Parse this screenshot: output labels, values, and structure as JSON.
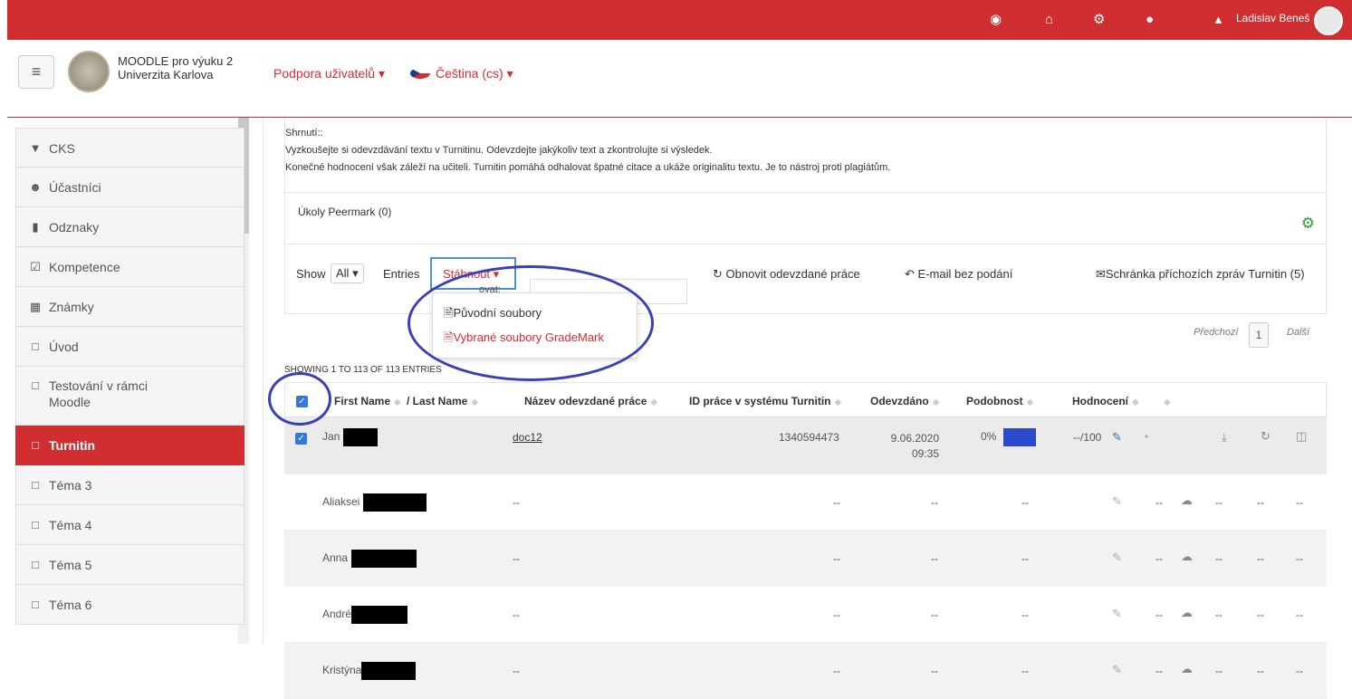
{
  "topbar": {
    "user_name": "Ladislav Beneš",
    "icons": [
      "dashboard-icon",
      "home-icon",
      "sitemap-icon",
      "chat-icon",
      "bell-icon"
    ]
  },
  "header": {
    "site_name_line1": "MOODLE pro výuku 2",
    "site_name_line2": "Univerzita Karlova",
    "menu_support": "Podpora uživatelů ▾",
    "menu_language": "Čeština (cs) ▾"
  },
  "sidebar": {
    "items": [
      {
        "label": "CKS",
        "icon": "graduation-cap-icon"
      },
      {
        "label": "Účastníci",
        "icon": "users-icon"
      },
      {
        "label": "Odznaky",
        "icon": "shield-icon"
      },
      {
        "label": "Kompetence",
        "icon": "check-square-icon"
      },
      {
        "label": "Známky",
        "icon": "table-icon"
      },
      {
        "label": "Úvod",
        "icon": "folder-icon"
      },
      {
        "label": "Testování v rámci",
        "label2": "Moodle",
        "icon": "folder-icon"
      },
      {
        "label": "Turnitin",
        "icon": "folder-icon"
      },
      {
        "label": "Téma 3",
        "icon": "folder-icon"
      },
      {
        "label": "Téma 4",
        "icon": "folder-icon"
      },
      {
        "label": "Téma 5",
        "icon": "folder-icon"
      },
      {
        "label": "Téma 6",
        "icon": "folder-icon"
      }
    ]
  },
  "summary": {
    "heading": "Shrnutí::",
    "line1": "Vyzkoušejte si odevzdávání textu v Turnitinu. Odevzdejte jakýkoliv text a zkontrolujte si výsledek.",
    "line2": "Konečné hodnocení však záleží na učiteli. Turnitin pomáhá odhalovat špatné citace a ukáže originalitu textu. Je to nástroj proti plagiátům."
  },
  "peermark": {
    "label": "Úkoly Peermark (0)"
  },
  "toolbar": {
    "show_label": "Show",
    "entries_value": "All",
    "entries_label": "Entries",
    "download_label": "Stáhnout ▾",
    "filter_label": "ovat:",
    "refresh_label": "Obnovit odevzdané práce",
    "email_label": "E-mail bez podání",
    "inbox_label": "Schránka příchozích zpráv Turnitin (5)"
  },
  "dropdown": {
    "item1": "Původní soubory",
    "item2": "Vybrané soubory GradeMark"
  },
  "pager": {
    "prev": "Předchozí",
    "page": "1",
    "next": "Další"
  },
  "showing_text": "SHOWING 1 TO 113 OF 113 ENTRIES",
  "table": {
    "headers": [
      "First Name",
      "/ Last Name",
      "Název odevzdané práce",
      "ID práce v systému Turnitin",
      "Odevzdáno",
      "Podobnost",
      "Hodnocení"
    ],
    "first_row": {
      "first_name": "Jan",
      "doc": "doc12",
      "paper_id": "1340594473",
      "submitted_line1": "9.06.2020",
      "submitted_line2": "09:35",
      "similarity": "0%",
      "grade": "--/100",
      "dot": "•"
    },
    "rows": [
      {
        "first_name": "Aliaksei",
        "doc": "--",
        "paper_id": "--",
        "submitted": "--",
        "similarity": "--",
        "d1": "--",
        "d2": "--",
        "d3": "--",
        "d4": "--"
      },
      {
        "first_name": "Anna",
        "doc": "--",
        "paper_id": "--",
        "submitted": "--",
        "similarity": "--",
        "d1": "--",
        "d2": "--",
        "d3": "--",
        "d4": "--"
      },
      {
        "first_name": "André",
        "doc": "--",
        "paper_id": "--",
        "submitted": "--",
        "similarity": "--",
        "d1": "--",
        "d2": "--",
        "d3": "--",
        "d4": "--"
      },
      {
        "first_name": "Kristýna",
        "doc": "--",
        "paper_id": "--",
        "submitted": "--",
        "similarity": "--",
        "d1": "--",
        "d2": "--",
        "d3": "--",
        "d4": "--"
      }
    ]
  },
  "colors": {
    "brand_red": "#d12e31",
    "annotation_blue": "#3b3fb4",
    "checkbox_blue": "#3579d6",
    "similarity_blue": "#2b4acb"
  }
}
